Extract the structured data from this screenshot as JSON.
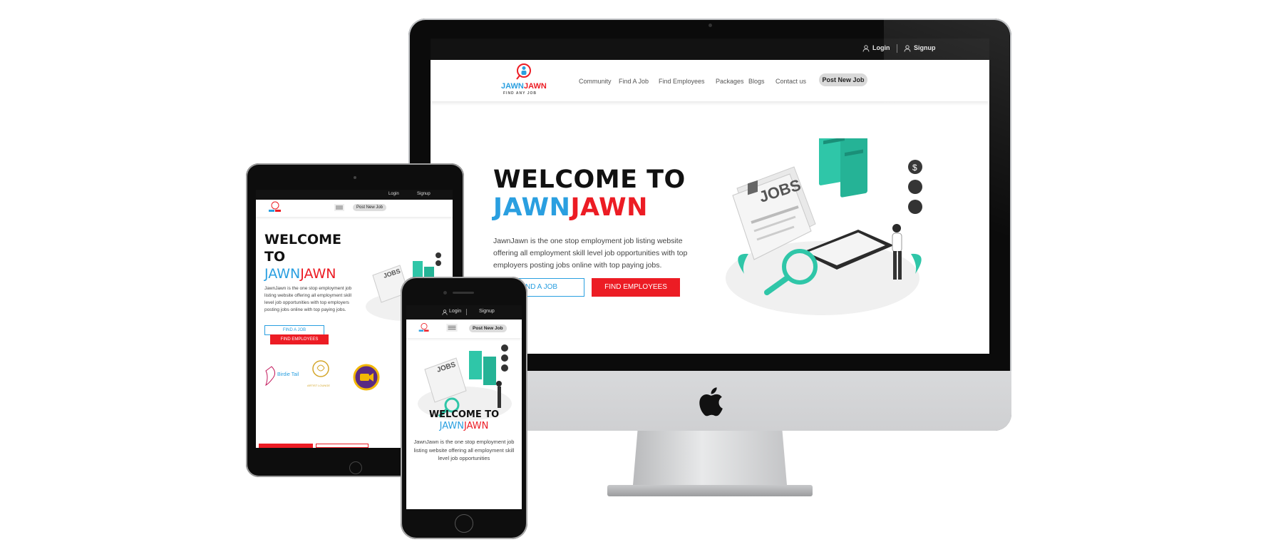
{
  "brand": {
    "name_part1": "JAWN",
    "name_part2": "JAWN",
    "tagline": "FIND ANY JOB"
  },
  "topbar": {
    "login": "Login",
    "signup": "Signup"
  },
  "nav": {
    "items": [
      "Community",
      "Find A Job",
      "Find Employees",
      "Packages",
      "Blogs",
      "Contact us"
    ],
    "post_job": "Post New Job"
  },
  "hero": {
    "title_line1": "WELCOME TO",
    "title_blue": "JAWN",
    "title_red": "JAWN",
    "description": "JawnJawn is the one stop employment job listing website offering all employment skill level job opportunities with top employers posting jobs online with top paying jobs.",
    "find_job_button": "FIND A JOB",
    "find_job_visible": "ND A JOB",
    "find_employees_button": "FIND EMPLOYEES"
  },
  "illustration": {
    "sign_text": "JOBS"
  },
  "tablet": {
    "title_line1": "WELCOME",
    "title_line2": "TO",
    "description": "JawnJawn is the one stop employment job listing website offering all employment skill level job opportunities with top employers posting jobs online with top paying jobs.",
    "partner_logos": [
      "Birdie Tail",
      "ARTIST LOUNGE"
    ]
  },
  "phone": {
    "title_line1": "WELCOME TO",
    "description": "JawnJawn is the one stop employment job listing website offering all employment skill level job opportunities"
  },
  "colors": {
    "brand_blue": "#2a9fe0",
    "brand_red": "#ec1c24",
    "topbar_bg": "#121212",
    "teal": "#2fc6a8"
  },
  "icons": [
    "user-icon",
    "signup-icon",
    "hamburger-icon",
    "apple-logo-icon",
    "magnifier-icon",
    "dollar-icon",
    "pin-icon"
  ]
}
